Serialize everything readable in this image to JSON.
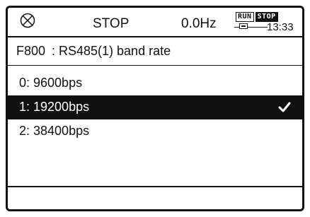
{
  "status": {
    "state": "STOP",
    "frequency": "0.0Hz",
    "mode_run": "RUN",
    "mode_stop": "STOP",
    "clock": "13:33"
  },
  "param": {
    "code": "F800",
    "title": ": RS485(1) band rate"
  },
  "options": [
    {
      "label": "0: 9600bps",
      "selected": false
    },
    {
      "label": "1: 19200bps",
      "selected": true
    },
    {
      "label": "2: 38400bps",
      "selected": false
    }
  ],
  "icons": {
    "stop": "circle-x-icon",
    "battery": "battery-icon",
    "check": "checkmark-icon"
  }
}
